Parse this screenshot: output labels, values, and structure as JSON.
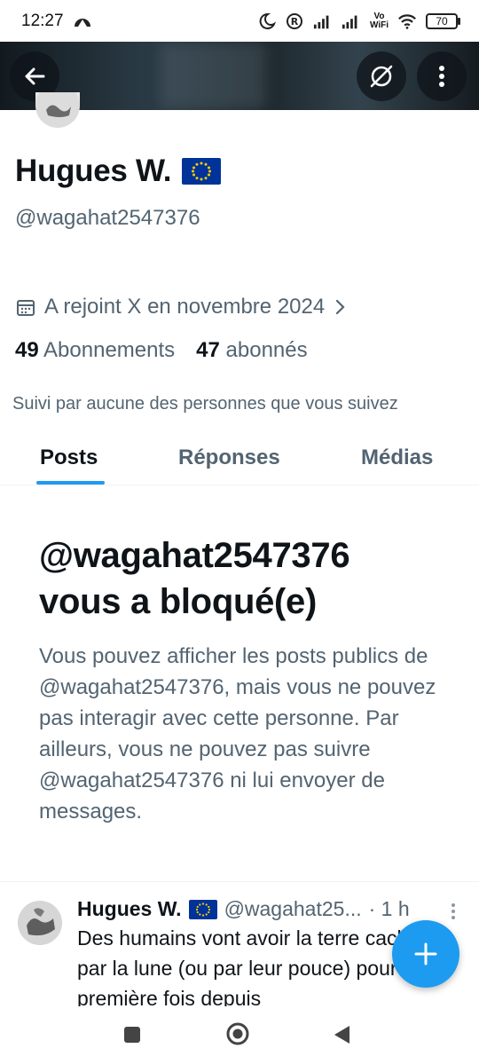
{
  "status_bar": {
    "time": "12:27",
    "volte_top": "Vo",
    "volte_bottom": "WiFi",
    "battery": "70"
  },
  "header": {
    "back_icon": "arrow-left-icon",
    "block_icon": "slashed-circle-icon",
    "more_icon": "vertical-dots-icon"
  },
  "profile": {
    "display_name": "Hugues W.",
    "flag": "eu-flag",
    "handle": "@wagahat2547376",
    "joined": "A rejoint X en novembre 2024",
    "following_count": "49",
    "following_label": "Abonnements",
    "followers_count": "47",
    "followers_label": "abonnés",
    "followed_by": "Suivi par aucune des personnes que vous suivez"
  },
  "tabs": [
    {
      "label": "Posts",
      "active": true
    },
    {
      "label": "Réponses",
      "active": false
    },
    {
      "label": "Médias",
      "active": false
    }
  ],
  "blocked": {
    "title_line1": "@wagahat2547376",
    "title_line2": "vous a bloqué(e)",
    "description": "Vous pouvez afficher les posts publics de @wagahat2547376, mais vous ne pouvez pas interagir avec cette personne. Par ailleurs, vous ne pouvez pas suivre @wagahat2547376 ni lui envoyer de messages."
  },
  "tweet": {
    "name": "Hugues W.",
    "handle": "@wagahat25...",
    "time": "· 1 h",
    "text": "Des humains vont avoir la terre cachée par la lune (ou par leur pouce) pour la première fois depuis"
  },
  "colors": {
    "accent": "#1d9bf0",
    "secondary_text": "#536471",
    "primary_text": "#0f1419"
  }
}
